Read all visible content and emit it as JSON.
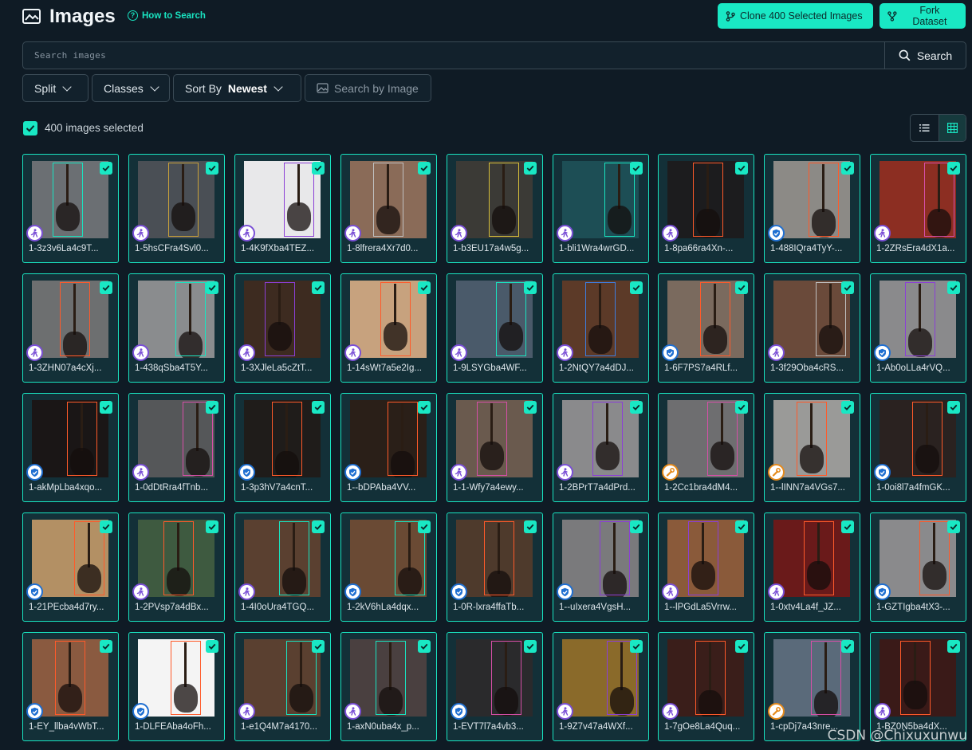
{
  "header": {
    "title": "Images",
    "how_to": "How to Search",
    "clone_label": "Clone 400 Selected Images",
    "fork_label": "Fork Dataset"
  },
  "search": {
    "placeholder": "Search images",
    "button_label": "Search"
  },
  "filters": {
    "split": "Split",
    "classes": "Classes",
    "sort_prefix": "Sort By",
    "sort_value": "Newest",
    "search_by_image": "Search by Image"
  },
  "selection": {
    "label": "400 images selected"
  },
  "colors": {
    "accent": "#19e8c4",
    "badge_purple": "#7a4fd6",
    "badge_blue": "#1f6fd1",
    "badge_orange": "#e58a1b"
  },
  "images": [
    {
      "name": "1-3z3v6La4c9T...",
      "badge": "person-icon",
      "bg": "#6b6f73",
      "box": "#19e4c1"
    },
    {
      "name": "1-5hsCFra4Svl0...",
      "badge": "person-icon",
      "bg": "#4a4f55",
      "box": "#c9a23a"
    },
    {
      "name": "1-4K9fXba4TEZ...",
      "badge": "person-icon",
      "bg": "#e8e8ea",
      "box": "#8b3fd6"
    },
    {
      "name": "1-8lfrera4Xr7d0...",
      "badge": "person-icon",
      "bg": "#8a6b58",
      "box": "#c0c0c0"
    },
    {
      "name": "1-b3EU17a4w5g...",
      "badge": "person-icon",
      "bg": "#3b3a36",
      "box": "#d8c13a"
    },
    {
      "name": "1-bli1Wra4wrGD...",
      "badge": "person-icon",
      "bg": "#1d4e55",
      "box": "#19e4c1"
    },
    {
      "name": "1-8pa66ra4Xn-...",
      "badge": "person-icon",
      "bg": "#1c1c1e",
      "box": "#ff5a2a"
    },
    {
      "name": "1-488IQra4TyY-...",
      "badge": "shield-icon",
      "bg": "#8c8a86",
      "box": "#ff5a2a"
    },
    {
      "name": "1-2ZRsEra4dX1a...",
      "badge": "person-icon",
      "bg": "#8c2e22",
      "box": "#d64fa8"
    },
    {
      "name": "1-3ZHN07a4cXj...",
      "badge": "person-icon",
      "bg": "#6d6f70",
      "box": "#ff5a2a"
    },
    {
      "name": "1-438qSba4T5Y...",
      "badge": "person-icon",
      "bg": "#8a8c8e",
      "box": "#19e4c1"
    },
    {
      "name": "1-3XJleLa5cZtT...",
      "badge": "person-icon",
      "bg": "#3d2b20",
      "box": "#8b3fd6"
    },
    {
      "name": "1-14sWt7a5e2Ig...",
      "badge": "person-icon",
      "bg": "#c7a27e",
      "box": "#ff5a2a"
    },
    {
      "name": "1-9LSYGba4WF...",
      "badge": "person-icon",
      "bg": "#4a5a6a",
      "box": "#19e4c1"
    },
    {
      "name": "1-2NtQY7a4dDJ...",
      "badge": "person-icon",
      "bg": "#5c3a28",
      "box": "#3d7ee0"
    },
    {
      "name": "1-6F7PS7a4RLf...",
      "badge": "shield-icon",
      "bg": "#7a6a5e",
      "box": "#ff5a2a"
    },
    {
      "name": "1-3f29Oba4cRS...",
      "badge": "person-icon",
      "bg": "#6a4a3a",
      "box": "#c0c0c0"
    },
    {
      "name": "1-Ab0oLLa4rVQ...",
      "badge": "shield-icon",
      "bg": "#8a8a8c",
      "box": "#8b3fd6"
    },
    {
      "name": "1-akMpLba4xqo...",
      "badge": "shield-icon",
      "bg": "#1a1616",
      "box": "#ff5a2a"
    },
    {
      "name": "1-0dDtRra4fTnb...",
      "badge": "person-icon",
      "bg": "#555759",
      "box": "#d64fa8"
    },
    {
      "name": "1-3p3hV7a4cnT...",
      "badge": "shield-icon",
      "bg": "#1f1c1a",
      "box": "#ff5a2a"
    },
    {
      "name": "1--bDPAba4VV...",
      "badge": "shield-icon",
      "bg": "#2a1f18",
      "box": "#ff5a2a"
    },
    {
      "name": "1-1-Wfy7a4ewy...",
      "badge": "person-icon",
      "bg": "#6a5a4e",
      "box": "#d64fa8"
    },
    {
      "name": "1-2BPrT7a4dPrd...",
      "badge": "person-icon",
      "bg": "#8a8a8c",
      "box": "#8b3fd6"
    },
    {
      "name": "1-2Cc1bra4dM4...",
      "badge": "wrench-icon",
      "bg": "#6e6e70",
      "box": "#d64fa8"
    },
    {
      "name": "1--lINN7a4VGs7...",
      "badge": "wrench-icon",
      "bg": "#9a9a98",
      "box": "#ff5a2a"
    },
    {
      "name": "1-0oi8l7a4fmGK...",
      "badge": "shield-icon",
      "bg": "#2a2220",
      "box": "#ff5a2a"
    },
    {
      "name": "1-21PEcba4d7ry...",
      "badge": "shield-icon",
      "bg": "#b39064",
      "box": "#ff5a2a"
    },
    {
      "name": "1-2PVsp7a4dBx...",
      "badge": "person-icon",
      "bg": "#3e5a40",
      "box": "#ff5a2a"
    },
    {
      "name": "1-4I0oUra4TGQ...",
      "badge": "person-icon",
      "bg": "#5a4030",
      "box": "#19e4c1"
    },
    {
      "name": "1-2kV6hLa4dqx...",
      "badge": "shield-icon",
      "bg": "#6a4a34",
      "box": "#19e4c1"
    },
    {
      "name": "1-0R-lxra4ffaTb...",
      "badge": "shield-icon",
      "bg": "#4e3a2c",
      "box": "#ff5a2a"
    },
    {
      "name": "1--uIxera4VgsH...",
      "badge": "shield-icon",
      "bg": "#7a7a7c",
      "box": "#8b3fd6"
    },
    {
      "name": "1--lPGdLa5Vrrw...",
      "badge": "person-icon",
      "bg": "#8a5a3a",
      "box": "#8b3fd6"
    },
    {
      "name": "1-0xtv4La4f_JZ...",
      "badge": "person-icon",
      "bg": "#6a1a1a",
      "box": "#ff5a2a"
    },
    {
      "name": "1-GZTIgba4tX3-...",
      "badge": "shield-icon",
      "bg": "#8a8a8c",
      "box": "#ff5a2a"
    },
    {
      "name": "1-EY_llba4vWbT...",
      "badge": "shield-icon",
      "bg": "#8a5a40",
      "box": "#ff5a2a"
    },
    {
      "name": "1-DLFEAba4oFh...",
      "badge": "shield-icon",
      "bg": "#f4f4f4",
      "box": "#ff5a2a"
    },
    {
      "name": "1-e1Q4M7a4170...",
      "badge": "person-icon",
      "bg": "#5a4030",
      "box": "#19e4c1"
    },
    {
      "name": "1-axN0uba4x_p...",
      "badge": "person-icon",
      "bg": "#4a4040",
      "box": "#19e4c1"
    },
    {
      "name": "1-EVT7l7a4vb3...",
      "badge": "shield-icon",
      "bg": "#2a2a2c",
      "box": "#d64fa8"
    },
    {
      "name": "1-9Z7v47a4WXf...",
      "badge": "person-icon",
      "bg": "#8a6a2a",
      "box": "#8b3fd6"
    },
    {
      "name": "1-7gOe8La4Quq...",
      "badge": "person-icon",
      "bg": "#3a1e1a",
      "box": "#ff5a2a"
    },
    {
      "name": "1-cpDj7a43nre...",
      "badge": "wrench-icon",
      "bg": "#5a6a7a",
      "box": "#d64fa8"
    },
    {
      "name": "1-BZ0N5ba4dX...",
      "badge": "person-icon",
      "bg": "#3a1a18",
      "box": "#ff5a2a"
    }
  ],
  "watermark": "CSDN @Chixuxunwu"
}
